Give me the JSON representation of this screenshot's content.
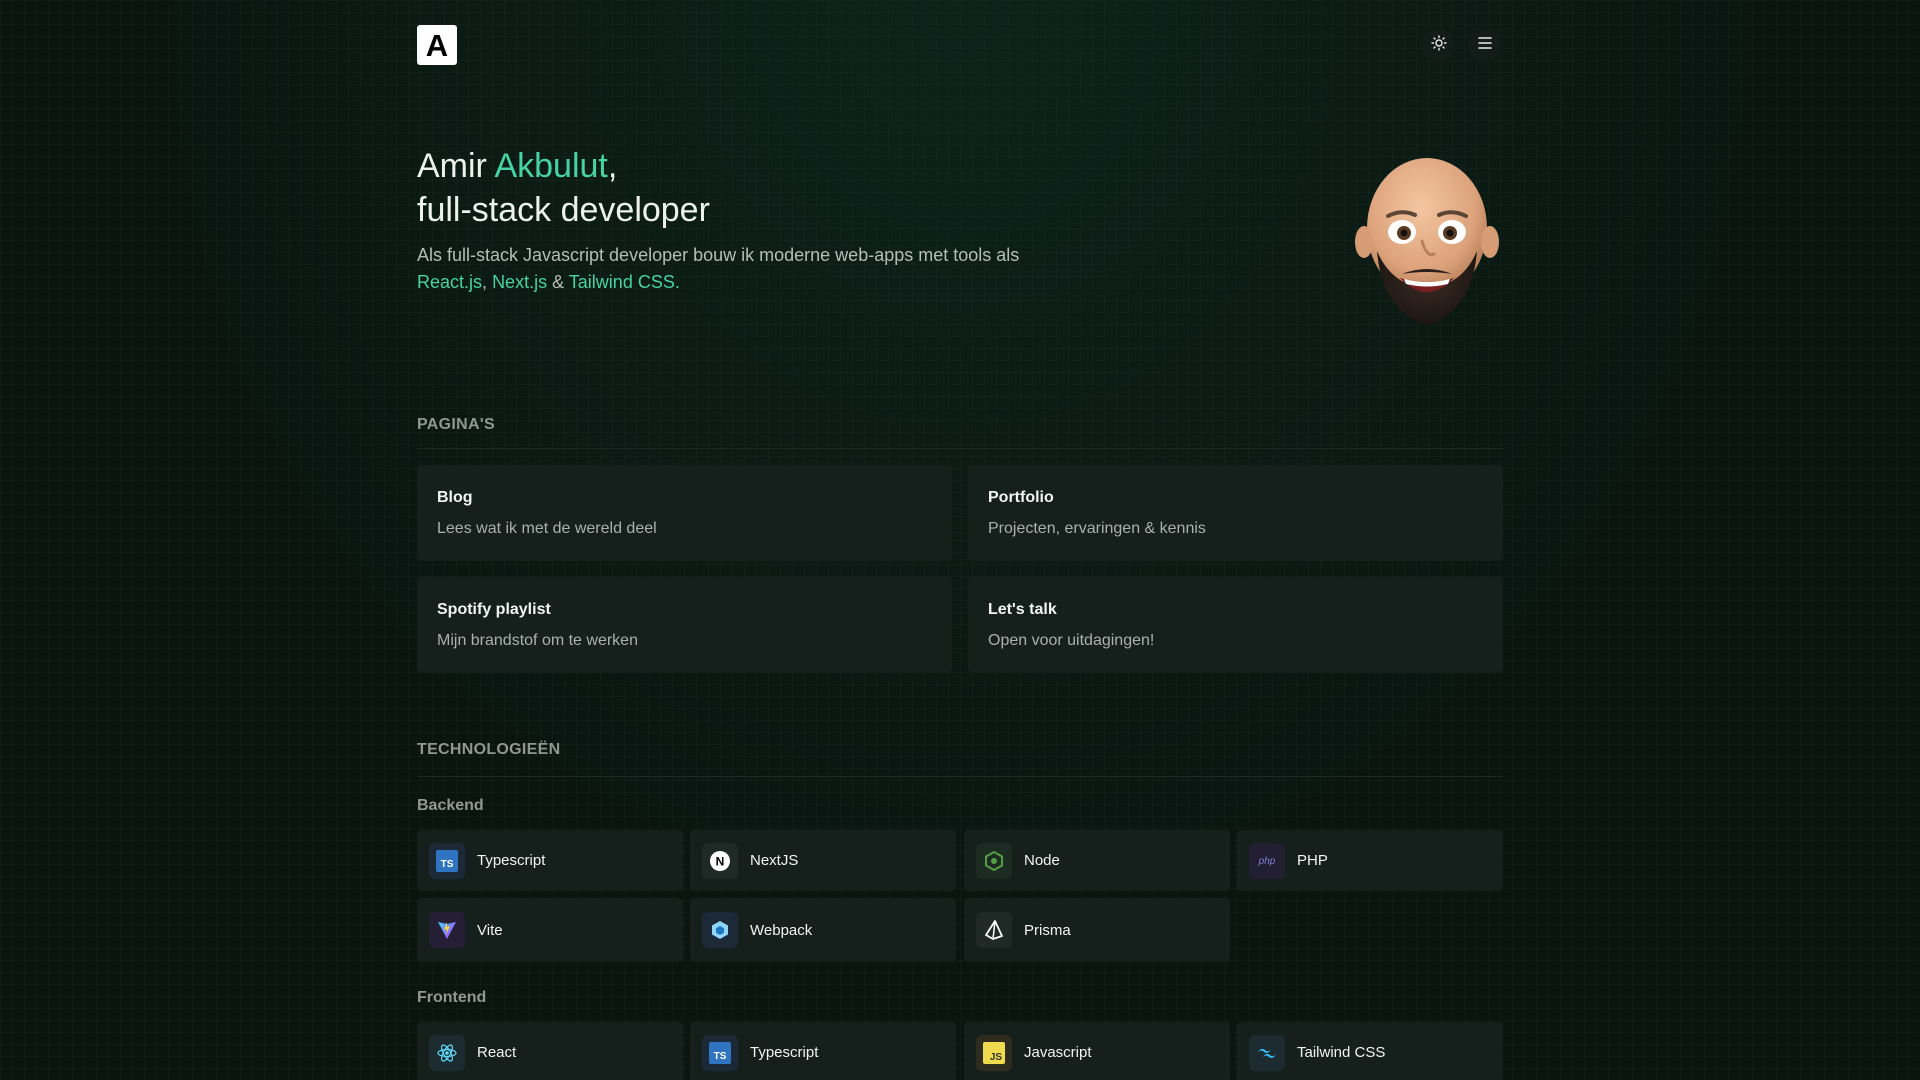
{
  "header": {
    "logo_letter": "A"
  },
  "hero": {
    "name_first": "Amir",
    "name_last": "Akbulut",
    "comma": ",",
    "role": "full-stack developer",
    "desc_prefix": "Als full-stack Javascript developer bouw ik moderne web-apps met tools als",
    "tool_1": "React.js",
    "sep_1": ",",
    "tool_2": "Next.js",
    "sep_2": "&",
    "tool_3": "Tailwind CSS",
    "period": "."
  },
  "pages": {
    "title": "PAGINA'S",
    "items": [
      {
        "title": "Blog",
        "desc": "Lees wat ik met de wereld deel"
      },
      {
        "title": "Portfolio",
        "desc": "Projecten, ervaringen & kennis"
      },
      {
        "title": "Spotify playlist",
        "desc": "Mijn brandstof om te werken"
      },
      {
        "title": "Let's talk",
        "desc": "Open voor uitdagingen!"
      }
    ]
  },
  "tech": {
    "title": "TECHNOLOGIEËN",
    "backend_label": "Backend",
    "backend": [
      {
        "label": "Typescript",
        "icon": "typescript-icon"
      },
      {
        "label": "NextJS",
        "icon": "nextjs-icon"
      },
      {
        "label": "Node",
        "icon": "node-icon"
      },
      {
        "label": "PHP",
        "icon": "php-icon"
      },
      {
        "label": "Vite",
        "icon": "vite-icon"
      },
      {
        "label": "Webpack",
        "icon": "webpack-icon"
      },
      {
        "label": "Prisma",
        "icon": "prisma-icon"
      }
    ],
    "frontend_label": "Frontend",
    "frontend": [
      {
        "label": "React",
        "icon": "react-icon"
      },
      {
        "label": "Typescript",
        "icon": "typescript-icon"
      },
      {
        "label": "Javascript",
        "icon": "javascript-icon"
      },
      {
        "label": "Tailwind CSS",
        "icon": "tailwind-icon"
      }
    ]
  },
  "colors": {
    "background": "#0a1510",
    "accent": "#46d3a5",
    "card": "#151f1b"
  }
}
